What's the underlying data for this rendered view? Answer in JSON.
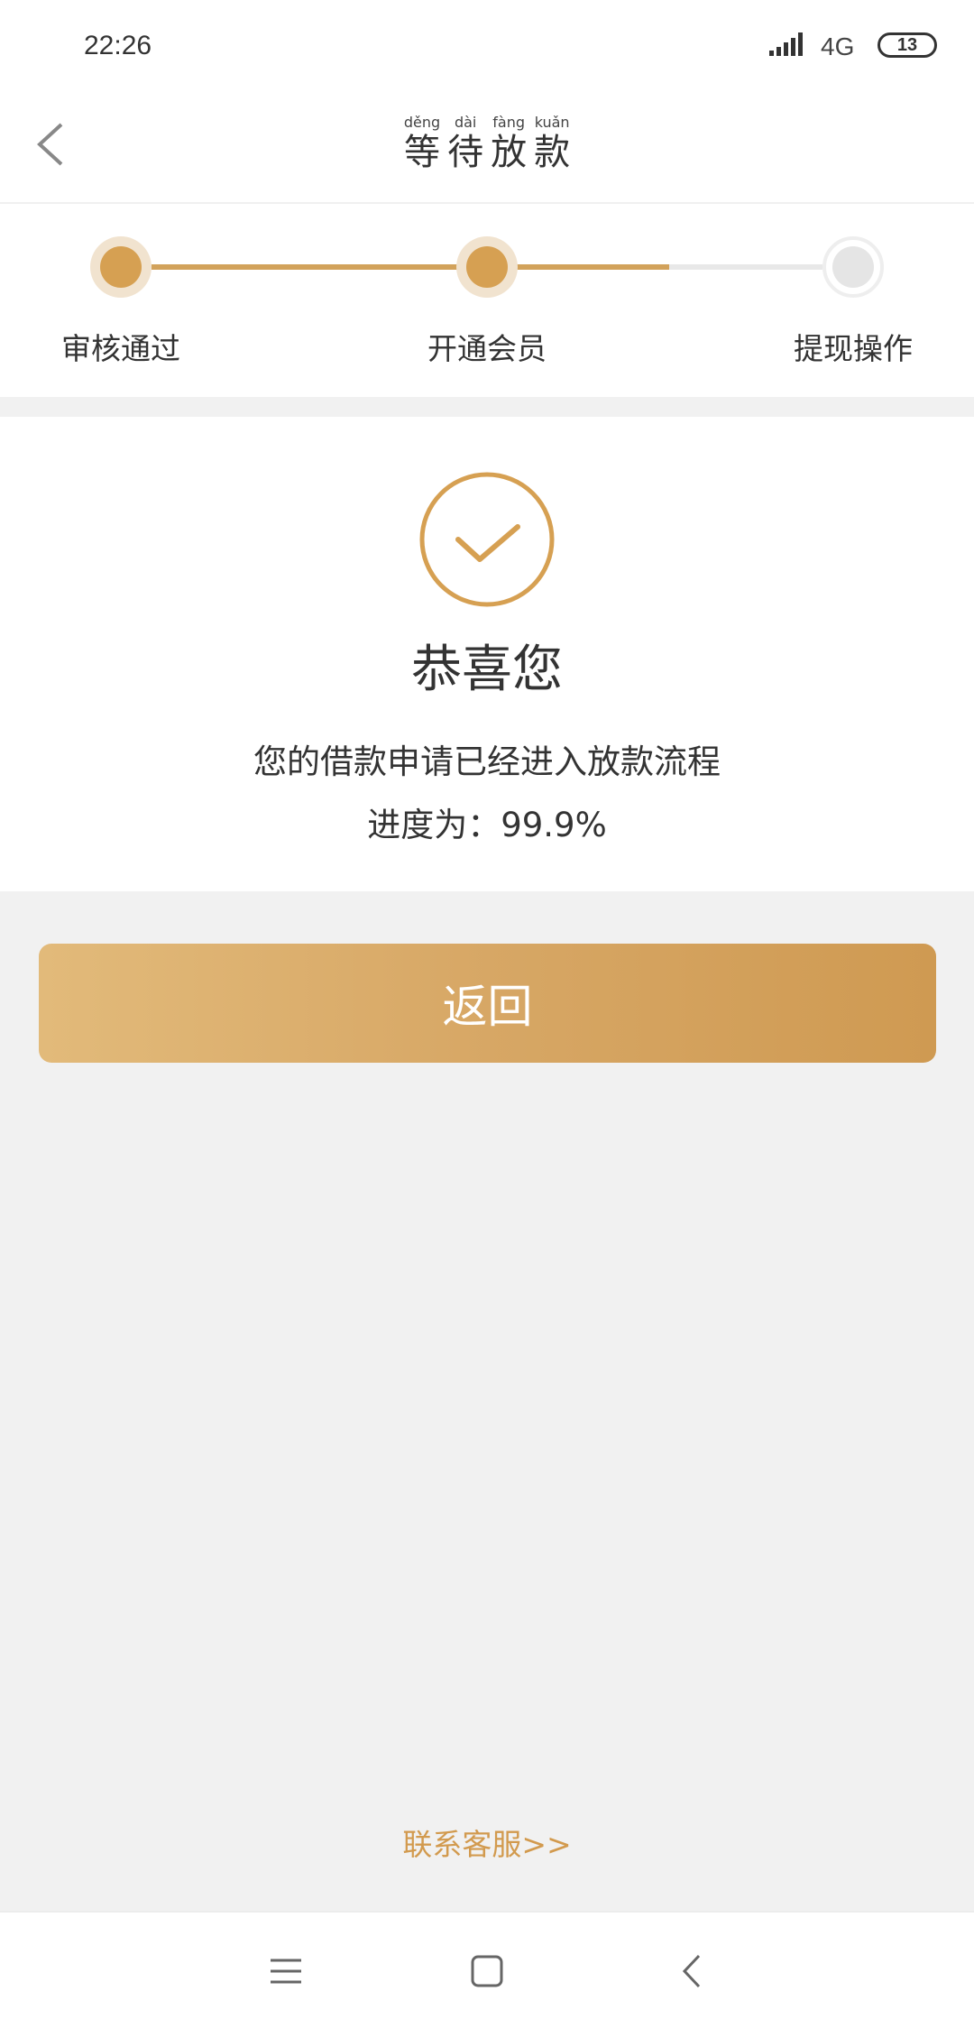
{
  "status_bar": {
    "time": "22:26",
    "network": "4G",
    "battery": "13",
    "icons": [
      "signal-icon",
      "battery-icon"
    ]
  },
  "nav": {
    "back_icon": "chevron-left-icon",
    "title_chars": [
      {
        "hanzi": "等",
        "pinyin": "děng"
      },
      {
        "hanzi": "待",
        "pinyin": "dài"
      },
      {
        "hanzi": "放",
        "pinyin": "fàng"
      },
      {
        "hanzi": "款",
        "pinyin": "kuǎn"
      }
    ]
  },
  "steps": {
    "items": [
      {
        "label": "审核通过",
        "state": "done"
      },
      {
        "label": "开通会员",
        "state": "done"
      },
      {
        "label": "提现操作",
        "state": "pending"
      }
    ],
    "accent_color": "#d2a25b"
  },
  "result": {
    "icon": "check-circle-icon",
    "title": "恭喜您",
    "message": "您的借款申请已经进入放款流程",
    "progress_text": "进度为：99.9%"
  },
  "actions": {
    "return_label": "返回",
    "contact_label": "联系客服>>"
  },
  "system_nav": {
    "icons": [
      "menu-icon",
      "home-icon",
      "back-icon"
    ]
  }
}
